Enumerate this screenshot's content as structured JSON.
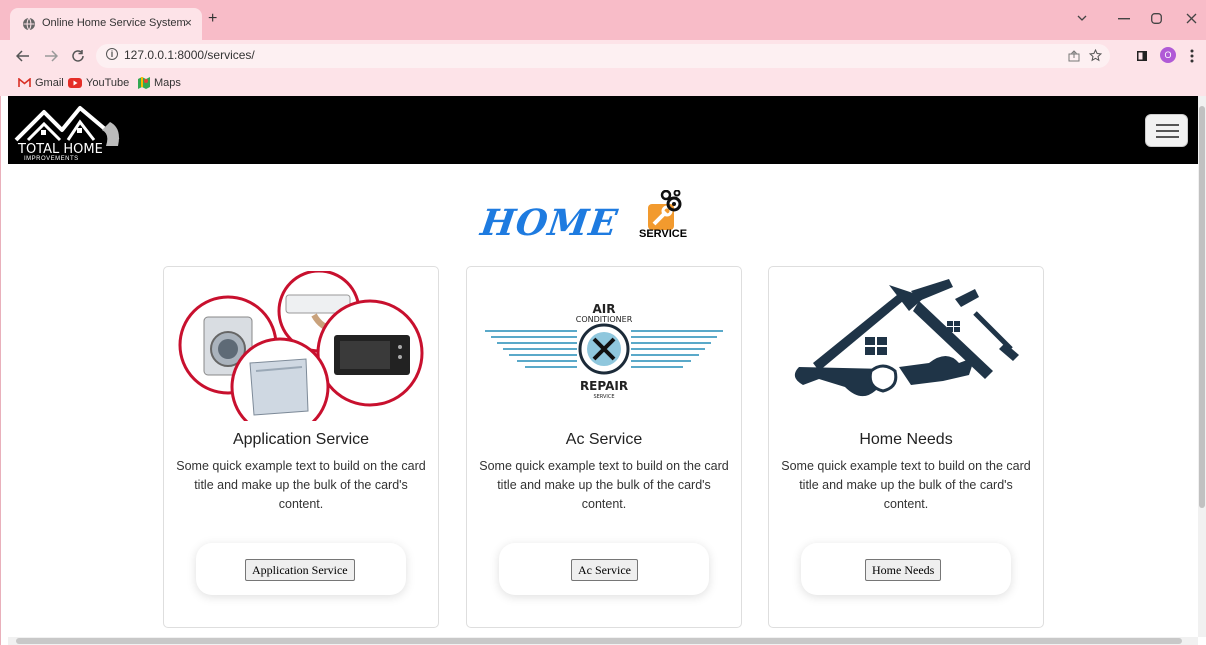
{
  "browser": {
    "tab_title": "Online Home Service System",
    "tab_close": "×",
    "new_tab": "+",
    "url": "127.0.0.1:8000/services/",
    "bookmarks": [
      {
        "label": "Gmail",
        "icon": "gmail-icon"
      },
      {
        "label": "YouTube",
        "icon": "youtube-icon"
      },
      {
        "label": "Maps",
        "icon": "maps-icon"
      }
    ],
    "profile_initial": "O",
    "colors": {
      "tabbar": "#f8bcc8",
      "toolbar": "#fde3e8"
    }
  },
  "navbar": {
    "logo_line1": "TOTAL HOME",
    "logo_line2": "IMPROVEMENTS"
  },
  "brand": {
    "home_text": "HOME",
    "service_text": "SERVICE"
  },
  "cards": [
    {
      "title": "Application Service",
      "text": "Some quick example text to build on the card title and make up the bulk of the card's content.",
      "button": "Application Service",
      "image": "appliances-image"
    },
    {
      "title": "Ac Service",
      "text": "Some quick example text to build on the card title and make up the bulk of the card's content.",
      "button": "Ac Service",
      "image": "ac-repair-image",
      "image_text": {
        "top": "AIR",
        "sub": "CONDITIONER",
        "bottom": "REPAIR",
        "bottom_sub": "SERVICE"
      }
    },
    {
      "title": "Home Needs",
      "text": "Some quick example text to build on the card title and make up the bulk of the card's content.",
      "button": "Home Needs",
      "image": "home-tools-image"
    }
  ]
}
